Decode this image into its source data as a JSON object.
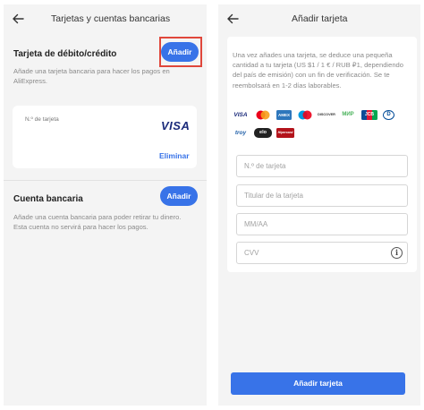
{
  "left": {
    "header": {
      "title": "Tarjetas y cuentas bancarias"
    },
    "card_section": {
      "title": "Tarjeta de débito/crédito",
      "add_label": "Añadir",
      "description": "Añade una tarjeta bancaria para hacer los pagos en AliExpress.",
      "saved_card": {
        "number_label": "N.º de tarjeta",
        "brand": "VISA",
        "remove_label": "Eliminar"
      }
    },
    "bank_section": {
      "title": "Cuenta bancaria",
      "add_label": "Añadir",
      "description": "Añade una cuenta bancaria para poder retirar tu dinero. Esta cuenta no servirá para hacer los pagos."
    }
  },
  "right": {
    "header": {
      "title": "Añadir tarjeta"
    },
    "notice": "Una vez añades una tarjeta, se deduce una pequeña cantidad a tu tarjeta (US $1 / 1 € / RUB ₽1, dependiendo del país de emisión) con un fin de verificación. Se te reembolsará en 1-2 días laborables.",
    "payment_logos": [
      {
        "name": "visa-logo",
        "text": "VISA"
      },
      {
        "name": "mastercard-logo",
        "text": ""
      },
      {
        "name": "amex-logo",
        "text": "AMEX"
      },
      {
        "name": "maestro-logo",
        "text": ""
      },
      {
        "name": "discover-logo",
        "text": "DISCOVER"
      },
      {
        "name": "mir-logo",
        "text": "МИР"
      },
      {
        "name": "jcb-logo",
        "text": "JCB"
      },
      {
        "name": "diners-logo",
        "text": "D"
      },
      {
        "name": "troy-logo",
        "text": "troy"
      },
      {
        "name": "elo-logo",
        "text": "elo"
      },
      {
        "name": "hipercard-logo",
        "text": "Hipercard"
      }
    ],
    "form": {
      "card_number_placeholder": "N.º de tarjeta",
      "holder_placeholder": "Titular de la tarjeta",
      "expiry_placeholder": "MM/AA",
      "cvv_placeholder": "CVV"
    },
    "submit_label": "Añadir tarjeta"
  },
  "colors": {
    "accent": "#3873e8",
    "highlight": "#e0473b",
    "background": "#f4f4f4"
  }
}
